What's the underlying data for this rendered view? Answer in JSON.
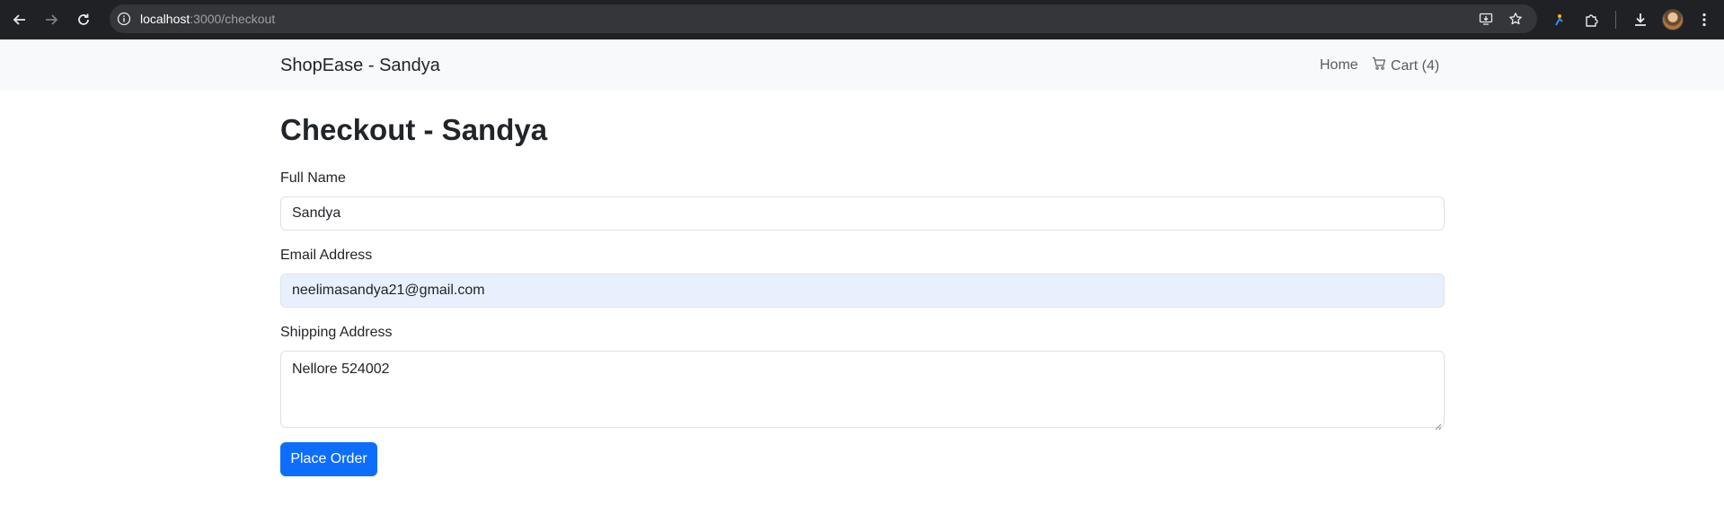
{
  "browser": {
    "url_host": "localhost",
    "url_path": ":3000/checkout",
    "icons": [
      "back-arrow-icon",
      "forward-arrow-icon",
      "reload-icon",
      "site-info-icon",
      "install-app-icon",
      "bookmark-star-icon",
      "extension-puzzle-icon",
      "download-icon",
      "more-menu-icon"
    ]
  },
  "navbar": {
    "brand": "ShopEase - Sandya",
    "home_label": "Home",
    "cart_label": "Cart (4)"
  },
  "page": {
    "title": "Checkout - Sandya"
  },
  "form": {
    "full_name_label": "Full Name",
    "full_name_value": "Sandya",
    "email_label": "Email Address",
    "email_value": "neelimasandya21@gmail.com",
    "address_label": "Shipping Address",
    "address_value": "Nellore 524002",
    "submit_label": "Place Order"
  },
  "colors": {
    "primary": "#0d6efd",
    "navbar_bg": "#f8f9fa",
    "autofill_bg": "#e8f0fe",
    "chrome_bg": "#202124"
  }
}
